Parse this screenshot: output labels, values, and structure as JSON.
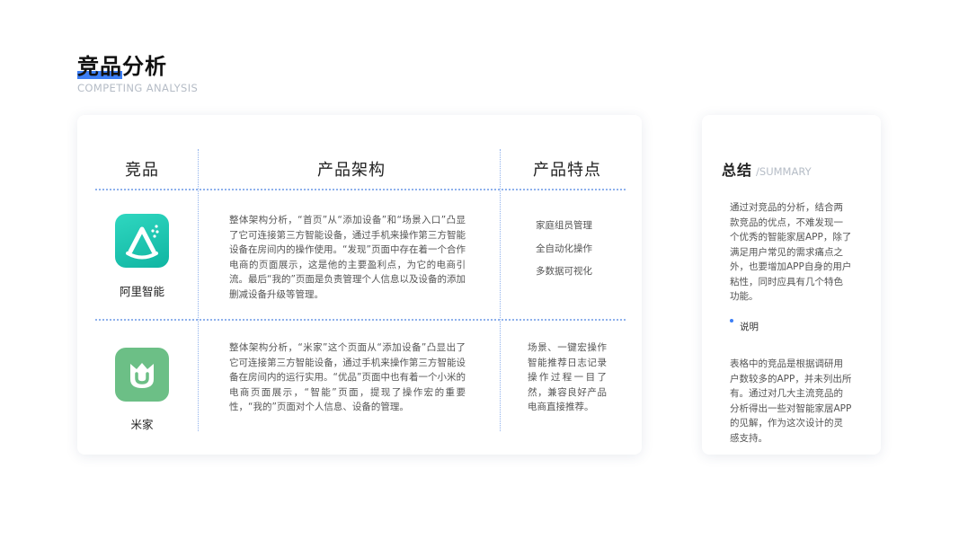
{
  "page": {
    "title": "竞品分析",
    "subtitle": "COMPETING ANALYSIS"
  },
  "table": {
    "headers": [
      "竞品",
      "产品架构",
      "产品特点"
    ],
    "rows": [
      {
        "app_name": "阿里智能",
        "app_icon": "alibaba-smart-icon",
        "architecture": "整体架构分析，“首页”从“添加设备”和“场景入口”凸显了它可连接第三方智能设备，通过手机来操作第三方智能设备在房间内的操作使用。“发现”页面中存在着一个合作电商的页面展示，这是他的主要盈利点，为它的电商引流。最后“我的”页面是负责管理个人信息以及设备的添加删减设备升级等管理。",
        "features": [
          "家庭组员管理",
          "全自动化操作",
          "多数据可视化"
        ]
      },
      {
        "app_name": "米家",
        "app_icon": "mijia-icon",
        "architecture": "整体架构分析，“米家”这个页面从“添加设备”凸显出了它可连接第三方智能设备，通过手机来操作第三方智能设备在房间内的运行实用。“优品”页面中也有着一个小米的电商页面展示，“智能”页面，提现了操作宏的重要性，“我的”页面对个人信息、设备的管理。",
        "features_text": "场景、一键宏操作智能推荐日志记录操作过程一目了然，兼容良好产品电商直接推荐。"
      }
    ]
  },
  "summary": {
    "title": "总结",
    "title_en": "/SUMMARY",
    "body": "通过对竞品的分析，结合两款竞品的优点，不难发现一个优秀的智能家居APP，除了满足用户常见的需求痛点之外，也要增加APP自身的用户粘性，同时应具有几个特色功能。",
    "note_label": "说明",
    "note_body": "表格中的竞品是根据调研用户数较多的APP，并未列出所有。通过对几大主流竞品的分析得出一些对智能家居APP的见解，作为这次设计的灵感支持。"
  },
  "colors": {
    "accent": "#3d7ff5",
    "alibaba_icon": "#18c3ae",
    "mijia_icon": "#6cbf86",
    "divider": "#8fb1ec"
  }
}
